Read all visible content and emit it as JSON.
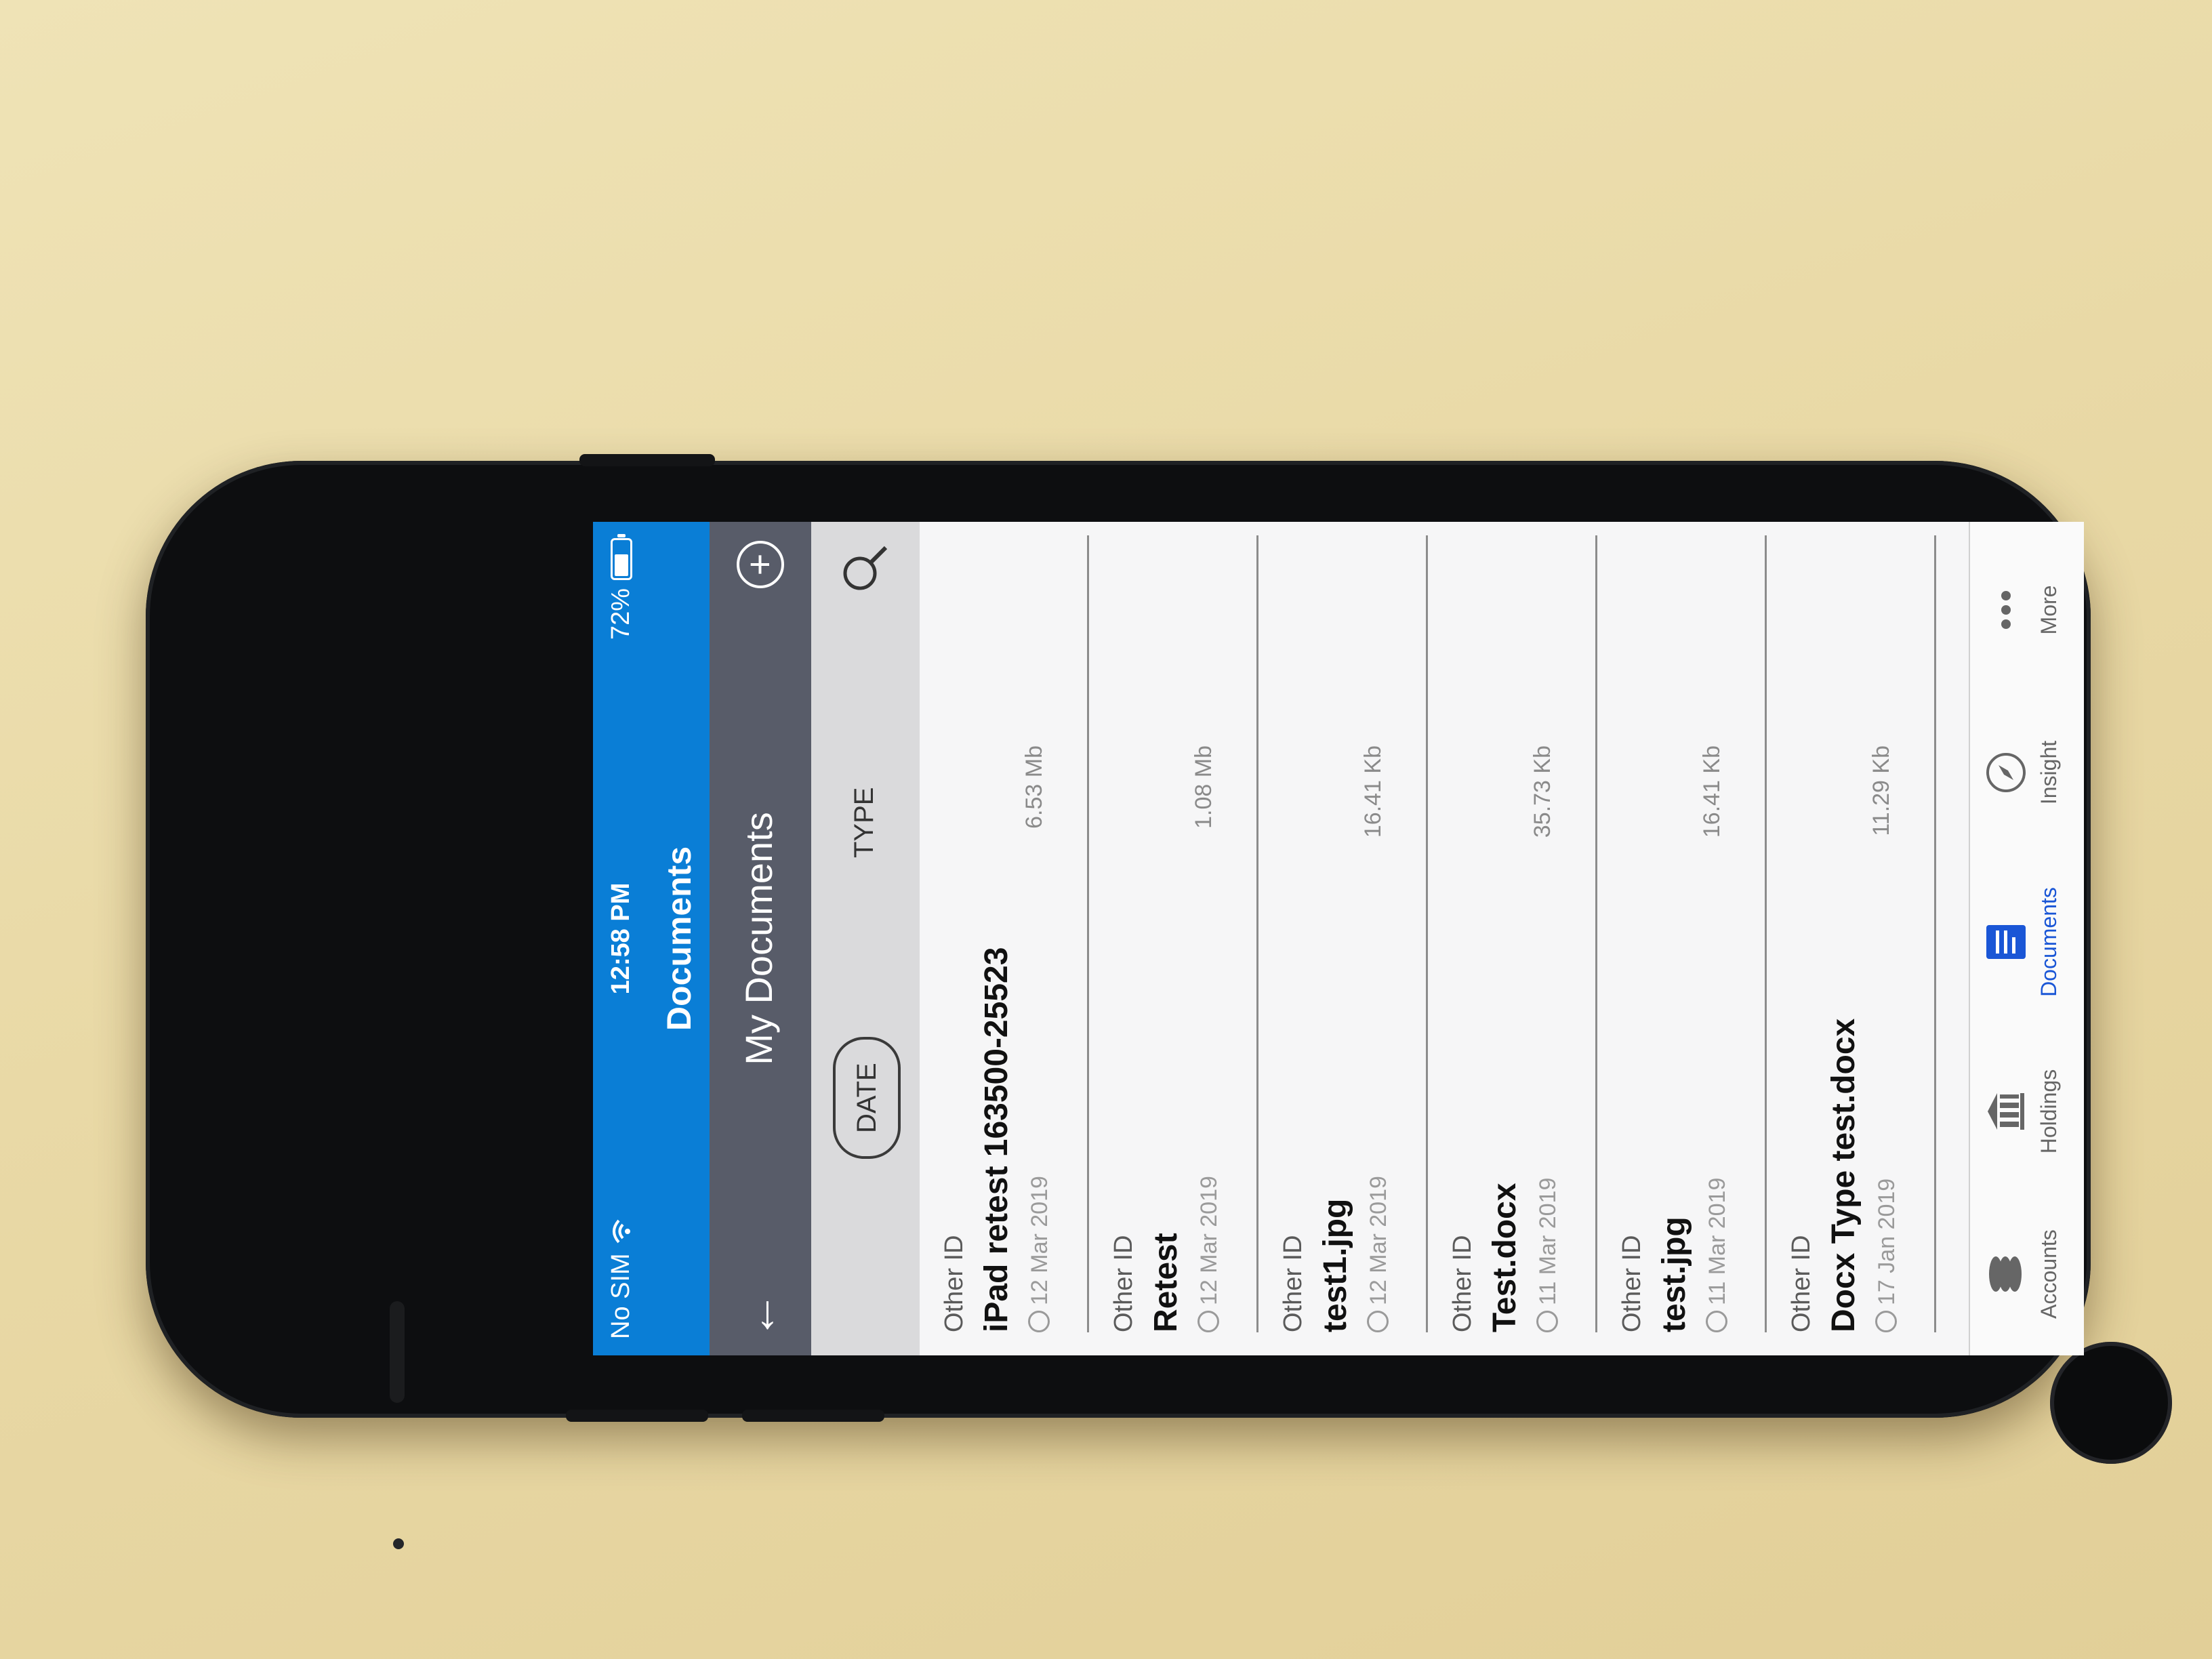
{
  "status_bar": {
    "carrier": "No SIM",
    "time": "12:58 PM",
    "battery_percent": "72%",
    "battery_level": 0.72
  },
  "app": {
    "title": "Documents"
  },
  "subheader": {
    "title": "My Documents"
  },
  "filters": {
    "date_label": "DATE",
    "type_label": "TYPE"
  },
  "documents": [
    {
      "kind": "Other ID",
      "name": "iPad retest 163500-25523",
      "date": "12 Mar 2019",
      "size": "6.53 Mb"
    },
    {
      "kind": "Other ID",
      "name": "Retest",
      "date": "12 Mar 2019",
      "size": "1.08 Mb"
    },
    {
      "kind": "Other ID",
      "name": "test1.jpg",
      "date": "12 Mar 2019",
      "size": "16.41 Kb"
    },
    {
      "kind": "Other ID",
      "name": "Test.docx",
      "date": "11 Mar 2019",
      "size": "35.73 Kb"
    },
    {
      "kind": "Other ID",
      "name": "test.jpg",
      "date": "11 Mar 2019",
      "size": "16.41 Kb"
    },
    {
      "kind": "Other ID",
      "name": "Docx Type test.docx",
      "date": "17 Jan 2019",
      "size": "11.29 Kb"
    }
  ],
  "tabs": [
    {
      "label": "Accounts",
      "icon": "coins-stack-icon"
    },
    {
      "label": "Holdings",
      "icon": "bank-building-icon"
    },
    {
      "label": "Documents",
      "icon": "document-list-icon",
      "active": true
    },
    {
      "label": "Insight",
      "icon": "compass-icon"
    },
    {
      "label": "More",
      "icon": "more-dots-icon"
    }
  ],
  "colors": {
    "header_blue": "#0a7ed6",
    "subheader_gray": "#585c69",
    "active_tab": "#1a56d6"
  }
}
